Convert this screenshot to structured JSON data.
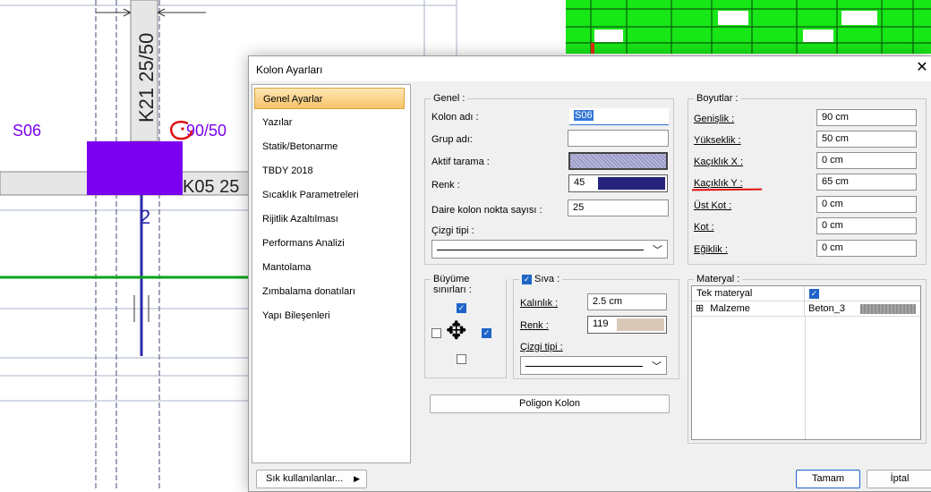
{
  "cad": {
    "section_label": "S06",
    "column_label": "K21 25/50",
    "column_dims_label": "90/50",
    "beam_label": "K05 25",
    "number_label": "2",
    "colors": {
      "purple": "#7b00f0",
      "green": "#0aa31a",
      "blue": "#2a2aa8",
      "red": "#e01010",
      "mesh_green": "#17e617"
    }
  },
  "dialog": {
    "title": "Kolon Ayarları",
    "nav": [
      {
        "label": "Genel Ayarlar",
        "active": true
      },
      {
        "label": "Yazılar"
      },
      {
        "label": "Statik/Betonarme"
      },
      {
        "label": "TBDY 2018"
      },
      {
        "label": "Sıcaklık Parametreleri"
      },
      {
        "label": "Rijitlik Azaltılması"
      },
      {
        "label": "Performans Analizi"
      },
      {
        "label": "Mantolama"
      },
      {
        "label": "Zımbalama donatıları"
      },
      {
        "label": "Yapı Bileşenleri"
      }
    ],
    "genel": {
      "title": "Genel :",
      "kolon_adi_label": "Kolon adı :",
      "kolon_adi_value": "S06",
      "grup_adi_label": "Grup adı:",
      "grup_adi_value": "",
      "aktif_tarama_label": "Aktif tarama :",
      "renk_label": "Renk :",
      "renk_value": "45",
      "renk_color": "#25237c",
      "daire_label": "Daire kolon nokta sayısı :",
      "daire_value": "25",
      "cizgi_tipi_label": "Çizgi tipi :"
    },
    "boyutlar": {
      "title": "Boyutlar :",
      "rows": [
        {
          "label": "Genişlik :",
          "value": "90 cm"
        },
        {
          "label": "Yükseklik :",
          "value": "50 cm"
        },
        {
          "label": "Kaçıklık X :",
          "value": "0 cm"
        },
        {
          "label": "Kaçıklık Y :",
          "value": "65 cm"
        },
        {
          "label": "Üst Kot :",
          "value": "0 cm"
        },
        {
          "label": "Kot :",
          "value": "0 cm"
        },
        {
          "label": "Eğiklik :",
          "value": "0 cm"
        }
      ]
    },
    "buyume": {
      "title": "Büyüme sınırları :"
    },
    "siva": {
      "title": "Sıva :",
      "kalinlik_label": "Kalınlık :",
      "kalinlik_value": "2.5 cm",
      "renk_label": "Renk :",
      "renk_value": "119",
      "renk_color": "#d8c8b8",
      "cizgi_tipi_label": "Çizgi tipi :"
    },
    "materyal": {
      "title": "Materyal :",
      "tek_materyal_label": "Tek materyal",
      "malzeme_label": "Malzeme",
      "malzeme_value": "Beton_3",
      "expand_glyph": "⊞"
    },
    "buttons": {
      "poligon": "Poligon Kolon",
      "sik": "Sık kullanılanlar...",
      "tamam": "Tamam",
      "iptal": "İptal"
    }
  }
}
